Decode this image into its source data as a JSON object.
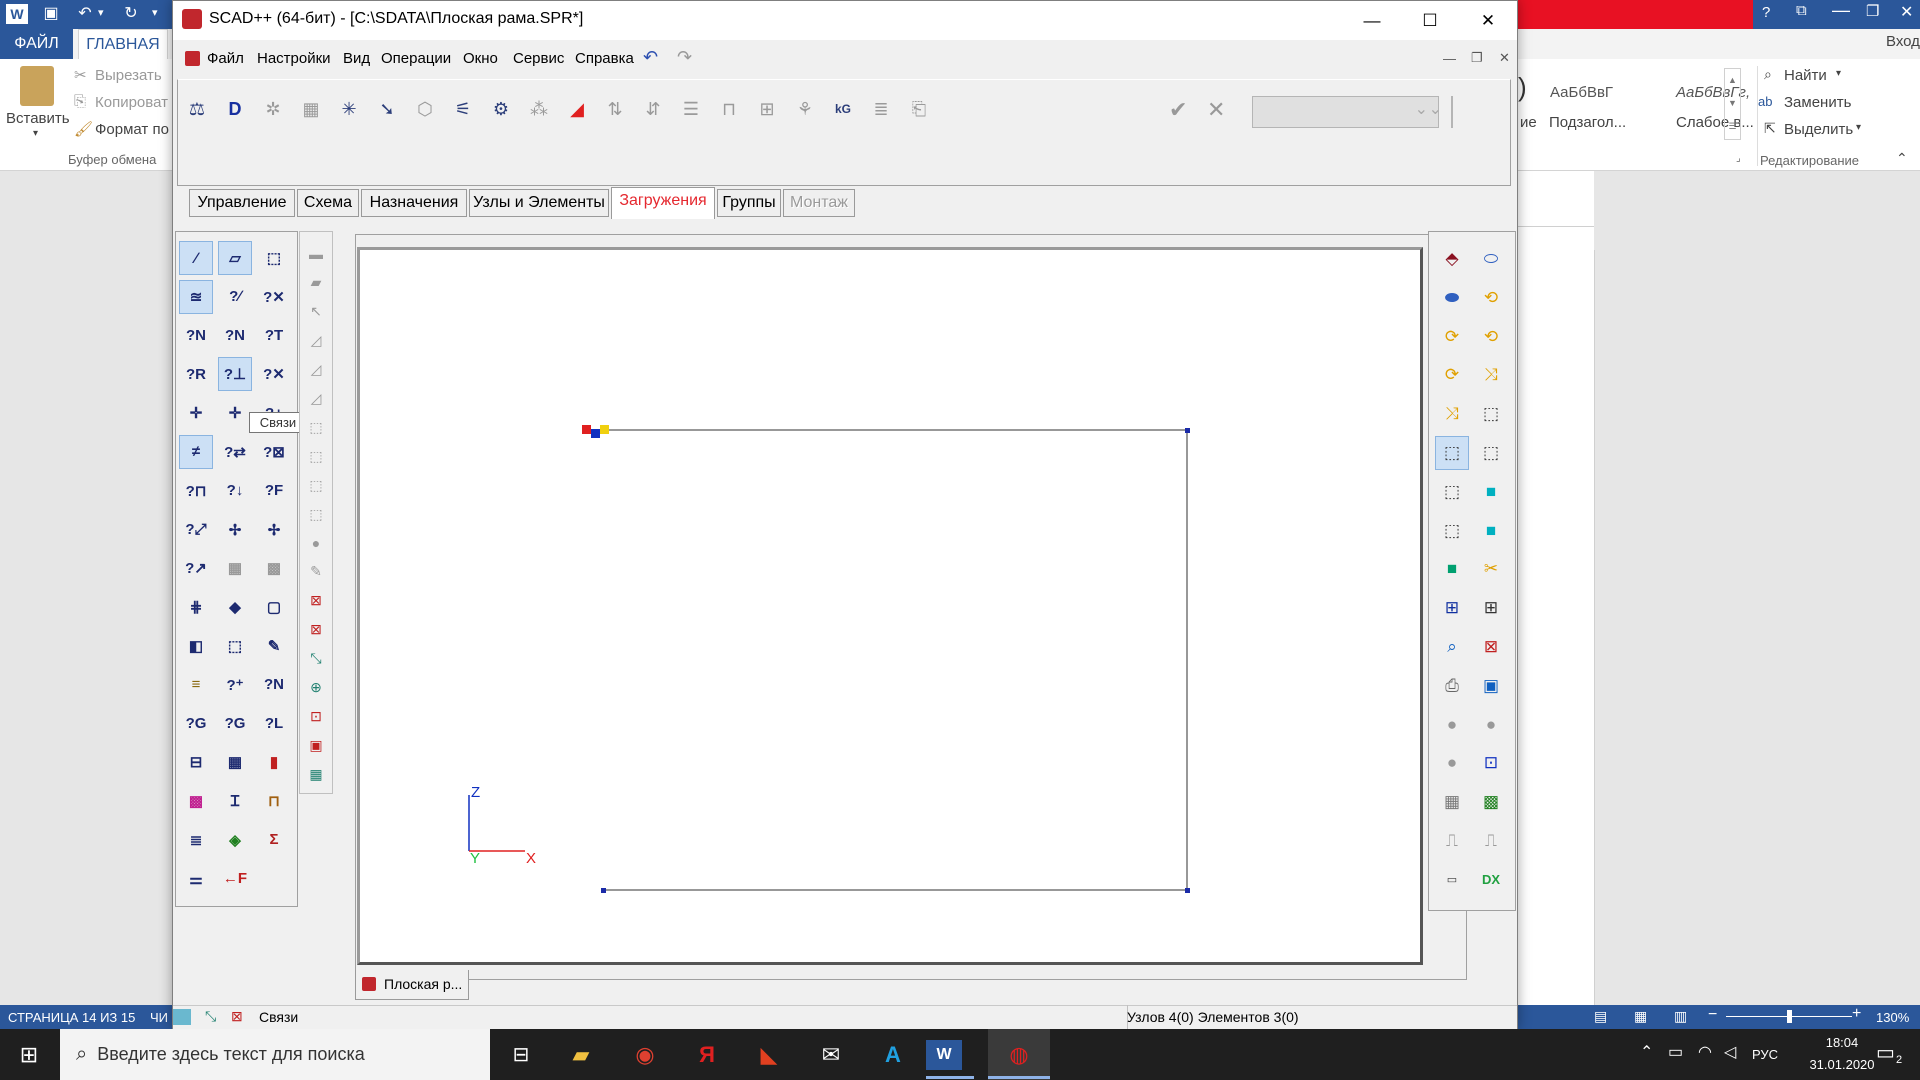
{
  "word": {
    "quick_access": {
      "undo_dropdown": "▾",
      "more": "▾"
    },
    "tabs": {
      "file": "ФАЙЛ",
      "home": "ГЛАВНАЯ"
    },
    "sign_in": "Вход",
    "help": "?",
    "clipboard": {
      "paste": "Вставить",
      "cut": "Вырезать",
      "copy": "Копироват",
      "format": "Формат по",
      "group": "Буфер обмена"
    },
    "styles": {
      "style1_preview": "АаБбВвГ",
      "style1_name": "Подзагол...",
      "style2_preview": "АаБбВвГг,",
      "style2_name": "Слабое в...",
      "partial_name": "ие"
    },
    "editing": {
      "find": "Найти",
      "replace": "Заменить",
      "select": "Выделить",
      "group": "Редактирование"
    },
    "status": {
      "page": "СТРАНИЦА 14 ИЗ 15",
      "partial": "ЧИ",
      "zoom": "130%"
    }
  },
  "scad": {
    "title": "SCAD++ (64-бит) - [C:\\SDATA\\Плоская рама.SPR*]",
    "window_controls": {
      "minimize": "—",
      "maximize": "☐",
      "close": "✕"
    },
    "menu": [
      "Файл",
      "Настройки",
      "Вид",
      "Операции",
      "Окно",
      "Сервис",
      "Справка"
    ],
    "tabs": [
      "Управление",
      "Схема",
      "Назначения",
      "Узлы и Элементы",
      "Загружения",
      "Группы",
      "Монтаж"
    ],
    "active_tab": "Загружения",
    "tooltip": "Связи",
    "axes": {
      "z": "Z",
      "y": "Y",
      "x": "X"
    },
    "doc_tab": "Плоская р...",
    "status": {
      "mode": "Связи",
      "info": "Узлов 4(0) Элементов 3(0)"
    },
    "frame_model": {
      "nodes": 4,
      "elements": 3
    }
  },
  "taskbar": {
    "search_placeholder": "Введите здесь текст для поиска",
    "lang": "РУС",
    "time": "18:04",
    "date": "31.01.2020",
    "notifications": "2"
  },
  "colors": {
    "word_blue": "#2b579a",
    "word_red_bar": "#e81123",
    "active_tab_text": "#e5282f",
    "axis_z": "#1030c0",
    "axis_y": "#20c040",
    "axis_x": "#e02020"
  }
}
